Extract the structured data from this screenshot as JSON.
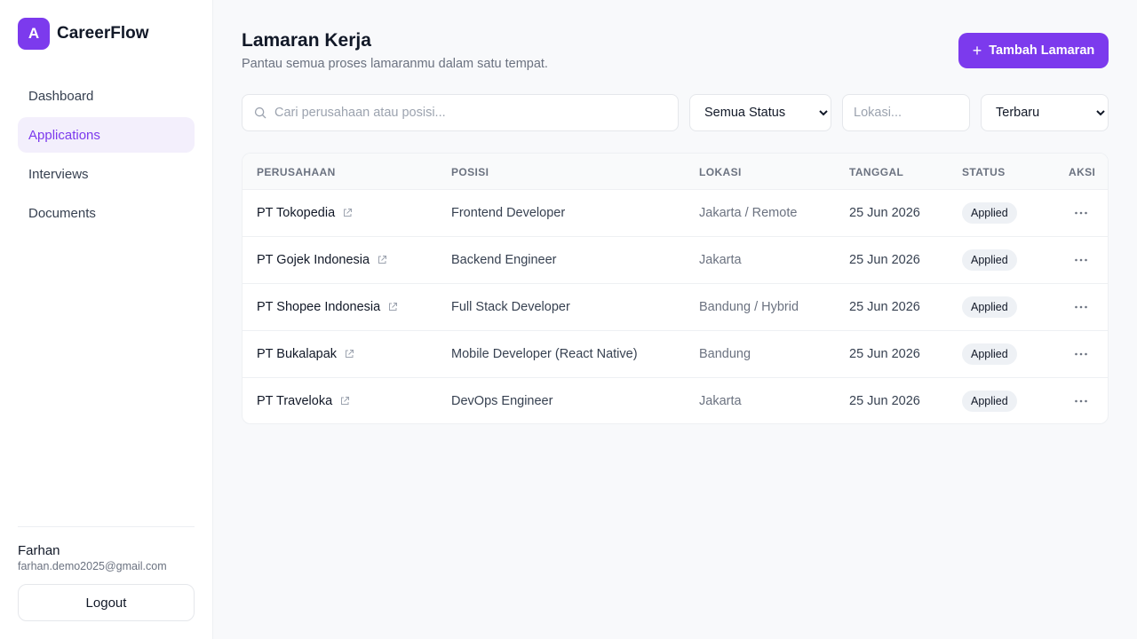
{
  "brand": {
    "logo_letter": "A",
    "name": "CareerFlow",
    "accent": "#7c3aed"
  },
  "sidebar": {
    "items": [
      {
        "label": "Dashboard",
        "active": false
      },
      {
        "label": "Applications",
        "active": true
      },
      {
        "label": "Interviews",
        "active": false
      },
      {
        "label": "Documents",
        "active": false
      }
    ],
    "user": {
      "name": "Farhan",
      "email": "farhan.demo2025@gmail.com"
    },
    "logout_label": "Logout"
  },
  "header": {
    "title": "Lamaran Kerja",
    "subtitle": "Pantau semua proses lamaranmu dalam satu tempat.",
    "add_label": "Tambah Lamaran",
    "add_icon": "plus-icon"
  },
  "filters": {
    "search_placeholder": "Cari perusahaan atau posisi...",
    "search_icon": "search-icon",
    "status_selected": "Semua Status",
    "location_placeholder": "Lokasi...",
    "sort_selected": "Terbaru"
  },
  "table": {
    "columns": [
      "PERUSAHAAN",
      "POSISI",
      "LOKASI",
      "TANGGAL",
      "STATUS",
      "AKSI"
    ],
    "rows": [
      {
        "company": "PT Tokopedia",
        "position": "Frontend Developer",
        "location": "Jakarta / Remote",
        "date": "25 Jun 2026",
        "status": "Applied"
      },
      {
        "company": "PT Gojek Indonesia",
        "position": "Backend Engineer",
        "location": "Jakarta",
        "date": "25 Jun 2026",
        "status": "Applied"
      },
      {
        "company": "PT Shopee Indonesia",
        "position": "Full Stack Developer",
        "location": "Bandung / Hybrid",
        "date": "25 Jun 2026",
        "status": "Applied"
      },
      {
        "company": "PT Bukalapak",
        "position": "Mobile Developer (React Native)",
        "location": "Bandung",
        "date": "25 Jun 2026",
        "status": "Applied"
      },
      {
        "company": "PT Traveloka",
        "position": "DevOps Engineer",
        "location": "Jakarta",
        "date": "25 Jun 2026",
        "status": "Applied"
      }
    ]
  }
}
